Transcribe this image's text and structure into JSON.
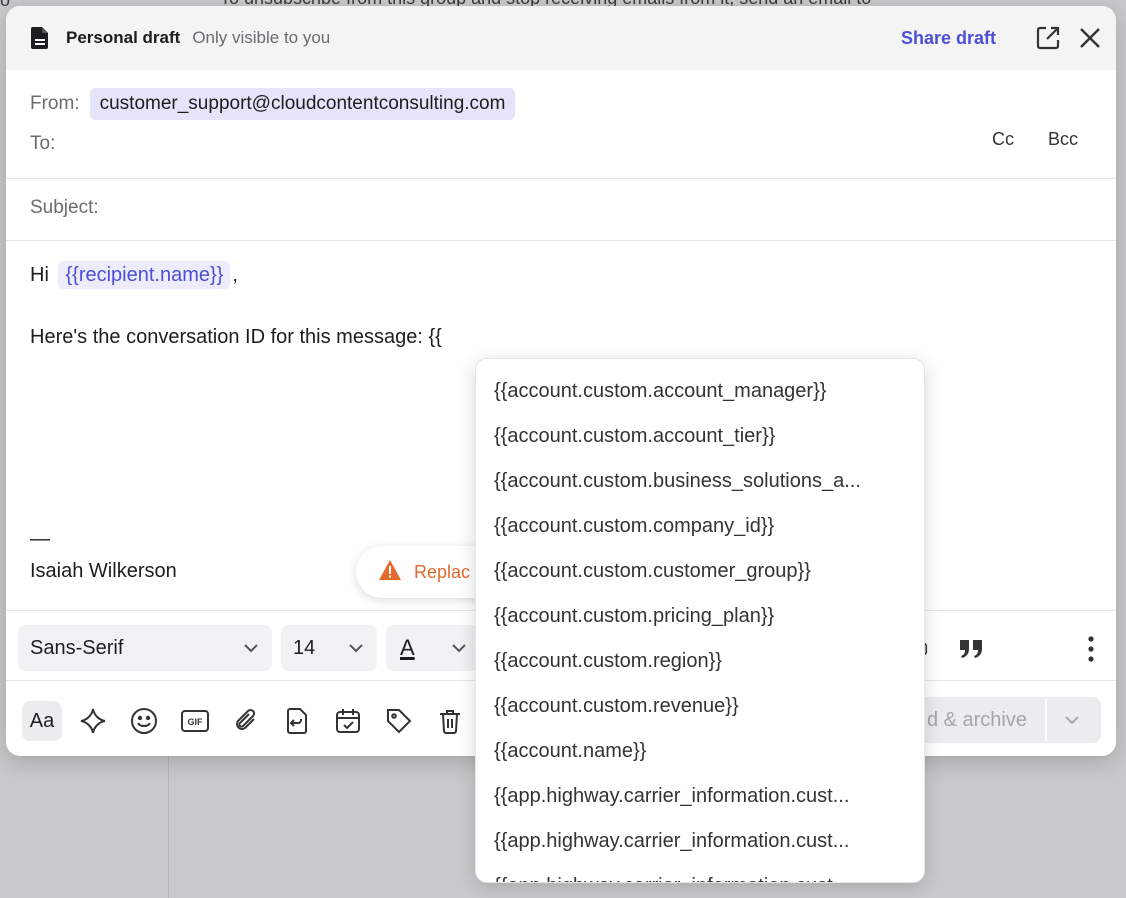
{
  "background": {
    "text": "To unsubscribe from this group and stop receiving emails from it, send an email to",
    "left_fragment": "o"
  },
  "header": {
    "title": "Personal draft",
    "subtitle": "Only visible to you",
    "share_label": "Share draft"
  },
  "from": {
    "label": "From:",
    "value": "customer_support@cloudcontentconsulting.com"
  },
  "to": {
    "label": "To:",
    "cc": "Cc",
    "bcc": "Bcc"
  },
  "subject": {
    "label": "Subject:"
  },
  "body": {
    "greeting": "Hi",
    "variable": "{{recipient.name}}",
    "comma": ",",
    "line2": "Here's the conversation ID for this message: {{",
    "sig_dash": "—",
    "sig_name": "Isaiah Wilkerson"
  },
  "warning": {
    "text": "Replac"
  },
  "format": {
    "font": "Sans-Serif",
    "size": "14",
    "color_letter": "A"
  },
  "actions": {
    "aa": "Aa",
    "gif": "GIF",
    "send_label": "d & archive"
  },
  "dropdown": {
    "items": [
      "{{account.custom.account_manager}}",
      "{{account.custom.account_tier}}",
      "{{account.custom.business_solutions_a...",
      "{{account.custom.company_id}}",
      "{{account.custom.customer_group}}",
      "{{account.custom.pricing_plan}}",
      "{{account.custom.region}}",
      "{{account.custom.revenue}}",
      "{{account.name}}",
      "{{app.highway.carrier_information.cust...",
      "{{app.highway.carrier_information.cust...",
      "{{app.highway.carrier_information.cust..."
    ]
  },
  "colors": {
    "accent": "#4d4fd6",
    "warning": "#e36a2e",
    "chip_bg": "#e4e4fa"
  }
}
